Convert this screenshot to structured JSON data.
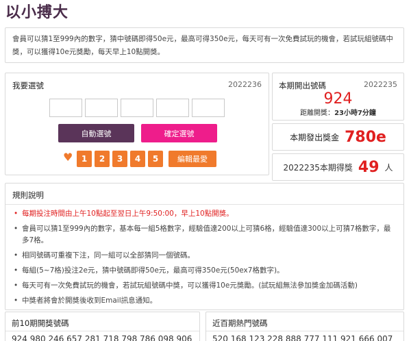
{
  "title": "以小搏大",
  "intro": "會員可以猜1至999內的數字，猜中號碼即得50e元，最高可得350e元，每天可有一次免費試玩的機會，若試玩組號碼中獎，可以獲得10e元獎勵，每天早上10點開獎。",
  "pick": {
    "heading": "我要選號",
    "issue": "2022236",
    "auto_label": "自動選號",
    "confirm_label": "確定選號",
    "quick_numbers": [
      "1",
      "2",
      "3",
      "4",
      "5"
    ],
    "edit_label": "編輯最愛"
  },
  "draw": {
    "heading": "本期開出號碼",
    "issue": "2022235",
    "number": "924",
    "countdown_label": "距離開獎：",
    "countdown_value": "23小時7分鐘"
  },
  "prize": {
    "label": "本期發出獎金",
    "value": "780e"
  },
  "winners": {
    "label": "2022235本期得獎",
    "value": "49",
    "unit": "人"
  },
  "rules": {
    "heading": "規則說明",
    "items": [
      "每期投注時間由上午10點起至翌日上午9:50:00，早上10點開獎。",
      "會員可以猜1至999內的數字，基本每一組5格數字，經驗值達200以上可猜6格，經驗值達300以上可猜7格數字，最多7格。",
      "相同號碼可重複下注，同一組可以全部猜同一個號碼。",
      "每組(5~7格)投注2e元，猜中號碼即得50e元，最高可得350e元(50ex7格數字)。",
      "每天可有一次免費試玩的機會，若試玩組號碼中獎，可以獲得10e元獎勵。(試玩組無法參加獎金加碼活動)",
      "中獎者將會於開獎後收到Email訊息通知。"
    ],
    "bullet": "•"
  },
  "prev10": {
    "heading": "前10期開獎號碼",
    "numbers": "924 980 246 657 281 718 798 786 098 906"
  },
  "hot100": {
    "heading": "近百期熱門號碼",
    "numbers": "520 168 123 228 888 777 111 921 666 007"
  },
  "colors": {
    "title": "#4a2c4a",
    "auto_button": "#5a3459",
    "confirm_button": "#ee1d8b",
    "orange": "#f07a2c",
    "red": "#e02020"
  },
  "icons": {
    "heart": "heart-icon"
  }
}
